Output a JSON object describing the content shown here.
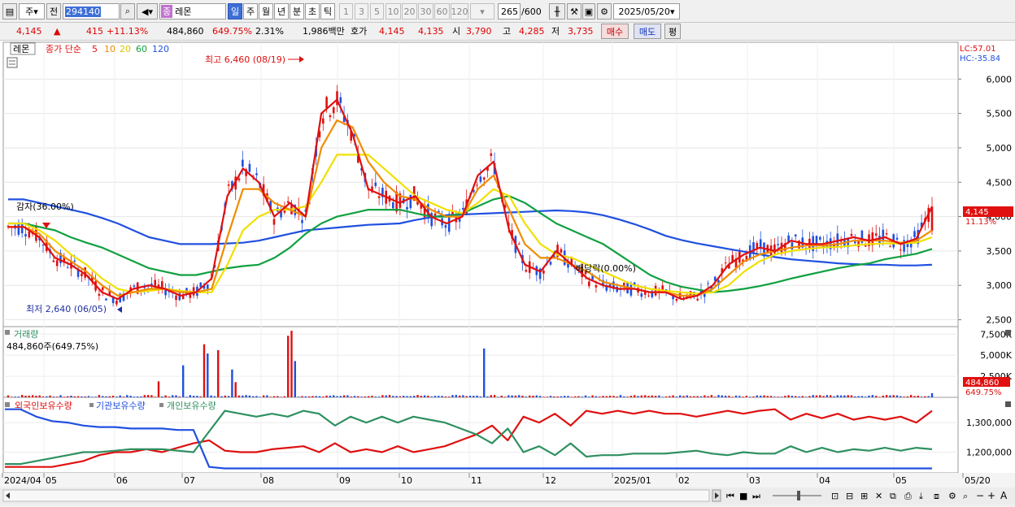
{
  "toolbar": {
    "type_select": "주",
    "prev_label": "전",
    "code": "294140",
    "market_tag": "종",
    "stock_name": "레몬",
    "periods": [
      "일",
      "주",
      "월",
      "년",
      "분",
      "초",
      "틱"
    ],
    "active_period": "일",
    "intervals": [
      "1",
      "3",
      "5",
      "10",
      "20",
      "30",
      "60",
      "120"
    ],
    "count": "265",
    "count_max": "/600",
    "date": "2025/05/20"
  },
  "quote": {
    "price": "4,145",
    "arrow": "▲",
    "change": "415",
    "change_pct": "+11.13%",
    "volume": "484,860",
    "volume_pct": "649.75%",
    "turnover": "2.31%",
    "amount": "1,986백만",
    "bid_label": "호가",
    "bid1": "4,145",
    "bid2": "4,135",
    "open_label": "시",
    "open": "3,790",
    "high_label": "고",
    "high": "4,285",
    "low_label": "저",
    "low": "3,735",
    "buy_label": "매수",
    "sell_label": "매도",
    "eval_label": "평"
  },
  "price_panel": {
    "stock": "레몬",
    "ma_prefix": "종가 단순",
    "ma_periods": [
      "5",
      "10",
      "20",
      "60",
      "120"
    ],
    "ma_colors": [
      "#e01010",
      "#f08c00",
      "#f0e000",
      "#10a040",
      "#2050e0"
    ],
    "lc": "LC:57.01",
    "hc": "HC:-35.84",
    "y_ticks": [
      "6,000",
      "5,500",
      "5,000",
      "4,500",
      "4,000",
      "3,500",
      "3,000",
      "2,500"
    ],
    "last_price": "4,145",
    "last_pct": "11.13%",
    "high_note": "최고 6,460 (08/19)",
    "low_note": "최저 2,640 (06/05)",
    "reduction_note": "감자(36.00%)",
    "dividend_note": "배당락(0.00%)"
  },
  "volume_panel": {
    "title": "거래량",
    "value": "484,860주(649.75%)",
    "y_ticks": [
      "7,500K",
      "5,000K",
      "2,500K"
    ],
    "last_value": "484,860",
    "last_pct": "649.75%"
  },
  "holdings_panel": {
    "legend": [
      "외국인보유수량",
      "기관보유수량",
      "개인보유수량"
    ],
    "colors": [
      "#e01010",
      "#2050e0",
      "#2e9060"
    ],
    "y_ticks": [
      "1,300,000",
      "1,200,000"
    ]
  },
  "x_axis": {
    "labels": [
      "2024/04",
      "05",
      "06",
      "07",
      "08",
      "09",
      "10",
      "11",
      "12",
      "2025/01",
      "02",
      "03",
      "04",
      "05",
      "05/20"
    ]
  },
  "chart_data": {
    "type": "line",
    "title": "",
    "price_ylim": [
      2400,
      6500
    ],
    "high": {
      "value": 6460,
      "date": "08/19"
    },
    "low": {
      "value": 2640,
      "date": "06/05"
    },
    "last_close": 4145,
    "series": [
      {
        "name": "5",
        "values": [
          3850,
          3850,
          3700,
          3400,
          3300,
          3150,
          2900,
          2800,
          2950,
          3000,
          2950,
          2850,
          2900,
          3100,
          4300,
          4700,
          4500,
          4000,
          4200,
          4000,
          5500,
          5700,
          5200,
          4400,
          4300,
          4200,
          4300,
          4000,
          3900,
          4000,
          4600,
          4800,
          3800,
          3300,
          3200,
          3500,
          3300,
          3100,
          3000,
          2950,
          2950,
          2900,
          2900,
          2800,
          2850,
          3000,
          3300,
          3450,
          3550,
          3500,
          3650,
          3600,
          3600,
          3650,
          3700,
          3650,
          3700,
          3600,
          3680,
          4145
        ]
      },
      {
        "name": "10",
        "values": [
          3850,
          3850,
          3750,
          3500,
          3350,
          3200,
          3000,
          2850,
          2900,
          2950,
          2950,
          2900,
          2900,
          2950,
          3700,
          4400,
          4400,
          4200,
          4100,
          4000,
          5000,
          5400,
          5300,
          4800,
          4500,
          4300,
          4250,
          4100,
          4000,
          4000,
          4400,
          4600,
          4100,
          3600,
          3400,
          3400,
          3300,
          3200,
          3050,
          3000,
          2950,
          2900,
          2900,
          2850,
          2850,
          2950,
          3150,
          3350,
          3450,
          3500,
          3550,
          3580,
          3580,
          3600,
          3650,
          3650,
          3650,
          3620,
          3650,
          3800
        ]
      },
      {
        "name": "20",
        "values": [
          3900,
          3900,
          3800,
          3650,
          3450,
          3300,
          3100,
          2950,
          2900,
          2920,
          2950,
          2920,
          2900,
          2900,
          3300,
          3800,
          4000,
          4100,
          4100,
          4150,
          4500,
          4900,
          4900,
          4900,
          4700,
          4500,
          4300,
          4200,
          4100,
          4050,
          4200,
          4400,
          4300,
          3900,
          3600,
          3450,
          3400,
          3300,
          3200,
          3100,
          3000,
          2950,
          2920,
          2900,
          2880,
          2900,
          3000,
          3200,
          3350,
          3450,
          3500,
          3530,
          3550,
          3560,
          3580,
          3600,
          3610,
          3610,
          3620,
          3700
        ]
      },
      {
        "name": "60",
        "values": [
          3900,
          3900,
          3850,
          3800,
          3700,
          3620,
          3550,
          3450,
          3350,
          3250,
          3200,
          3150,
          3150,
          3200,
          3250,
          3280,
          3300,
          3400,
          3550,
          3750,
          3900,
          4000,
          4050,
          4100,
          4100,
          4100,
          4050,
          4000,
          4000,
          4050,
          4150,
          4250,
          4300,
          4200,
          4050,
          3900,
          3800,
          3700,
          3600,
          3450,
          3300,
          3150,
          3050,
          2980,
          2940,
          2900,
          2920,
          2950,
          2990,
          3040,
          3100,
          3150,
          3200,
          3250,
          3290,
          3320,
          3380,
          3420,
          3460,
          3530
        ]
      },
      {
        "name": "120",
        "values": [
          4250,
          4250,
          4200,
          4150,
          4100,
          4050,
          3980,
          3900,
          3800,
          3700,
          3650,
          3600,
          3600,
          3600,
          3610,
          3620,
          3650,
          3700,
          3750,
          3800,
          3820,
          3840,
          3860,
          3880,
          3890,
          3900,
          3950,
          3990,
          4020,
          4030,
          4040,
          4050,
          4060,
          4070,
          4080,
          4090,
          4080,
          4060,
          4020,
          3960,
          3890,
          3810,
          3720,
          3660,
          3610,
          3570,
          3530,
          3490,
          3450,
          3410,
          3380,
          3360,
          3340,
          3320,
          3310,
          3300,
          3300,
          3290,
          3290,
          3300
        ]
      }
    ],
    "volume_ylim": [
      0,
      8200
    ],
    "volume_unit": "K",
    "volume_peaks": [
      {
        "i": 43,
        "v": 1900
      },
      {
        "i": 50,
        "v": 3800
      },
      {
        "i": 56,
        "v": 6300
      },
      {
        "i": 57,
        "v": 5200
      },
      {
        "i": 60,
        "v": 5600
      },
      {
        "i": 64,
        "v": 3300
      },
      {
        "i": 65,
        "v": 1800
      },
      {
        "i": 80,
        "v": 7300
      },
      {
        "i": 81,
        "v": 7900
      },
      {
        "i": 82,
        "v": 4300
      },
      {
        "i": 136,
        "v": 5800
      }
    ],
    "holdings_ylim": [
      1130000,
      1380000
    ],
    "holdings": [
      {
        "name": "외국인보유수량",
        "values": [
          1150000,
          1150000,
          1150000,
          1150000,
          1160000,
          1170000,
          1190000,
          1200000,
          1200000,
          1210000,
          1200000,
          1215000,
          1230000,
          1240000,
          1205000,
          1200000,
          1200000,
          1210000,
          1215000,
          1220000,
          1200000,
          1230000,
          1200000,
          1210000,
          1200000,
          1220000,
          1200000,
          1210000,
          1220000,
          1240000,
          1260000,
          1290000,
          1240000,
          1320000,
          1300000,
          1330000,
          1290000,
          1340000,
          1330000,
          1340000,
          1330000,
          1340000,
          1330000,
          1330000,
          1320000,
          1330000,
          1340000,
          1330000,
          1340000,
          1345000,
          1310000,
          1330000,
          1315000,
          1330000,
          1310000,
          1320000,
          1310000,
          1320000,
          1300000,
          1340000
        ]
      },
      {
        "name": "기관보유수량",
        "values": [
          1345000,
          1345000,
          1320000,
          1305000,
          1300000,
          1290000,
          1285000,
          1285000,
          1280000,
          1280000,
          1280000,
          1275000,
          1275000,
          1150000,
          1145000,
          1145000,
          1145000,
          1145000,
          1145000,
          1145000,
          1145000,
          1145000,
          1145000,
          1145000,
          1145000,
          1145000,
          1145000,
          1145000,
          1145000,
          1145000,
          1145000,
          1145000,
          1145000,
          1145000,
          1145000,
          1145000,
          1145000,
          1145000,
          1145000,
          1145000,
          1145000,
          1145000,
          1145000,
          1145000,
          1145000,
          1145000,
          1145000,
          1145000,
          1145000,
          1145000,
          1145000,
          1145000,
          1145000,
          1145000,
          1145000,
          1145000,
          1145000,
          1145000,
          1145000,
          1145000
        ]
      },
      {
        "name": "개인보유수량",
        "values": [
          1160000,
          1160000,
          1170000,
          1180000,
          1190000,
          1200000,
          1200000,
          1205000,
          1210000,
          1210000,
          1210000,
          1205000,
          1200000,
          1270000,
          1340000,
          1330000,
          1320000,
          1330000,
          1320000,
          1340000,
          1330000,
          1290000,
          1320000,
          1300000,
          1320000,
          1300000,
          1320000,
          1310000,
          1300000,
          1280000,
          1260000,
          1230000,
          1280000,
          1200000,
          1220000,
          1190000,
          1230000,
          1185000,
          1190000,
          1190000,
          1195000,
          1195000,
          1195000,
          1200000,
          1205000,
          1195000,
          1190000,
          1200000,
          1195000,
          1195000,
          1220000,
          1200000,
          1215000,
          1200000,
          1210000,
          1205000,
          1215000,
          1205000,
          1215000,
          1210000
        ]
      }
    ]
  }
}
